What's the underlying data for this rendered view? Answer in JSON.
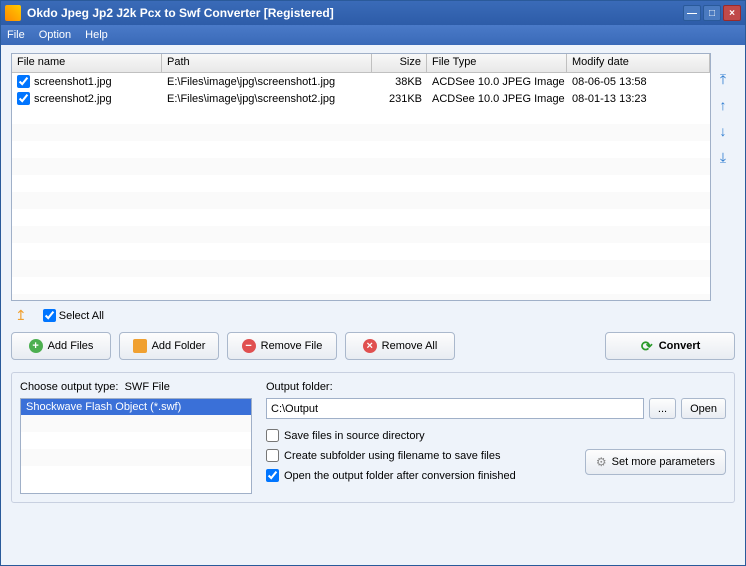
{
  "window": {
    "title": "Okdo Jpeg Jp2 J2k Pcx to Swf Converter [Registered]"
  },
  "menu": {
    "file": "File",
    "option": "Option",
    "help": "Help"
  },
  "columns": {
    "name": "File name",
    "path": "Path",
    "size": "Size",
    "type": "File Type",
    "date": "Modify date"
  },
  "files": [
    {
      "checked": true,
      "name": "screenshot1.jpg",
      "path": "E:\\Files\\image\\jpg\\screenshot1.jpg",
      "size": "38KB",
      "type": "ACDSee 10.0 JPEG Image",
      "date": "08-06-05 13:58"
    },
    {
      "checked": true,
      "name": "screenshot2.jpg",
      "path": "E:\\Files\\image\\jpg\\screenshot2.jpg",
      "size": "231KB",
      "type": "ACDSee 10.0 JPEG Image",
      "date": "08-01-13 13:23"
    }
  ],
  "selectAll": {
    "label": "Select All",
    "checked": true
  },
  "buttons": {
    "addFiles": "Add Files",
    "addFolder": "Add Folder",
    "removeFile": "Remove File",
    "removeAll": "Remove All",
    "convert": "Convert"
  },
  "outputType": {
    "label": "Choose output type:",
    "current": "SWF File",
    "selected": "Shockwave Flash Object (*.swf)"
  },
  "outputFolder": {
    "label": "Output folder:",
    "value": "C:\\Output",
    "browse": "...",
    "open": "Open"
  },
  "options": {
    "saveSource": {
      "label": "Save files in source directory",
      "checked": false
    },
    "createSub": {
      "label": "Create subfolder using filename to save files",
      "checked": false
    },
    "openAfter": {
      "label": "Open the output folder after conversion finished",
      "checked": true
    }
  },
  "moreParams": "Set more parameters"
}
